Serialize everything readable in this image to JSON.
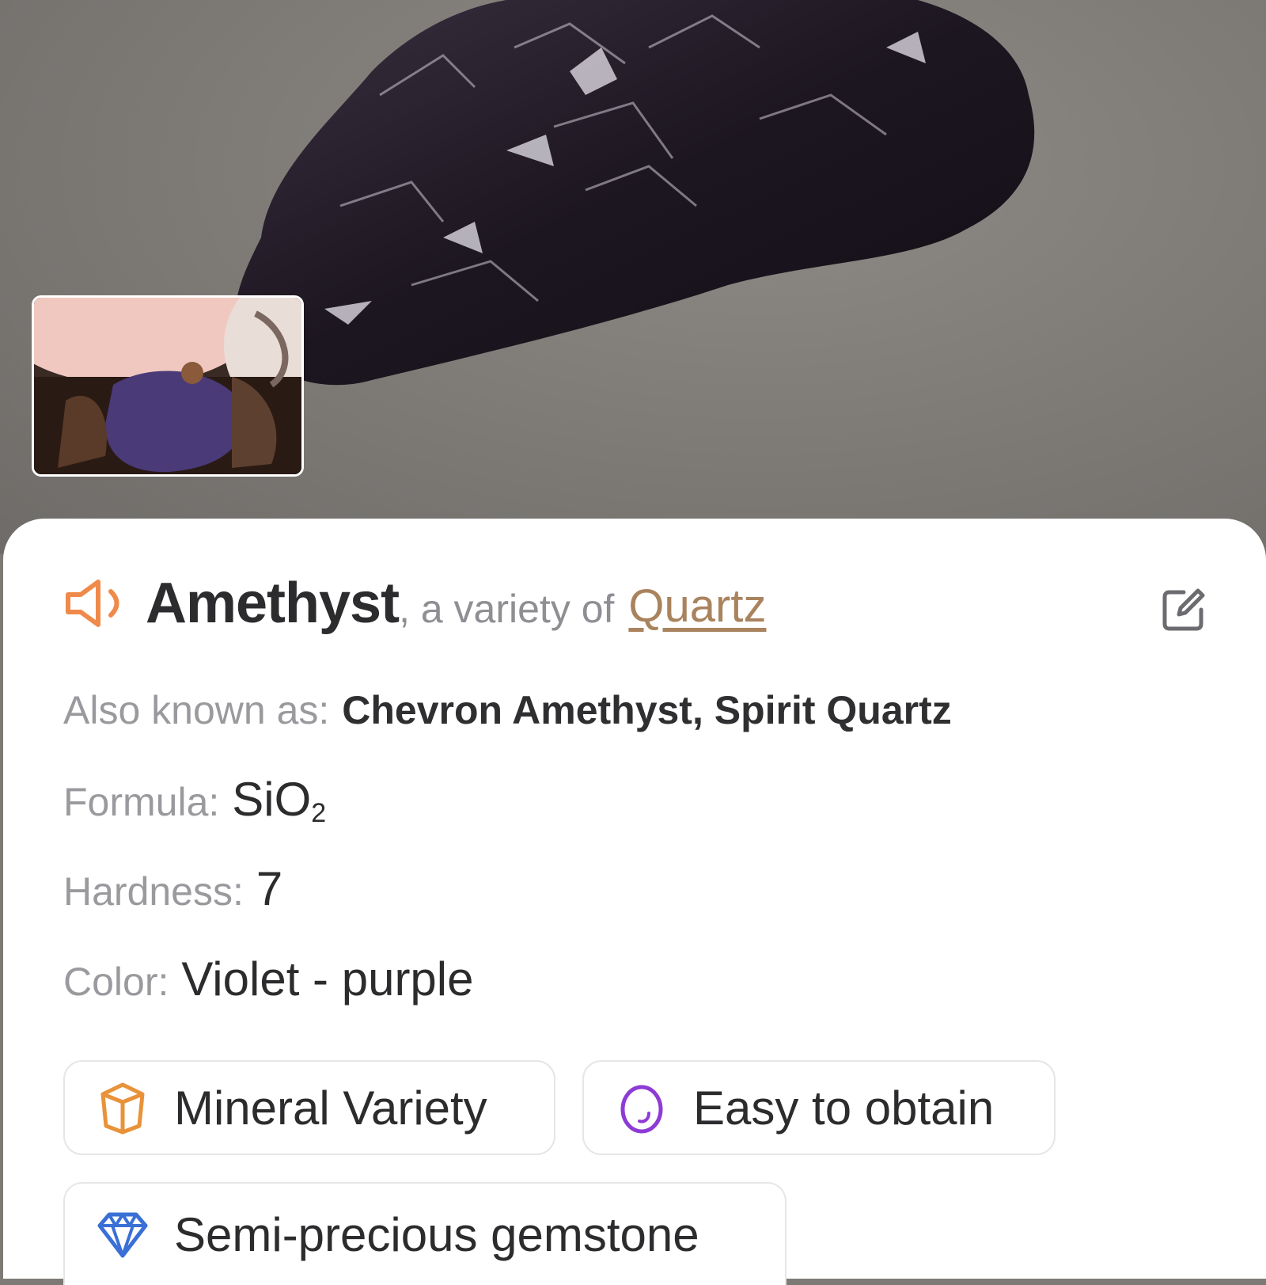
{
  "specimen": {
    "name": "Amethyst",
    "variety_prefix": ", a variety of",
    "variety_link": "Quartz"
  },
  "details": {
    "aka_label": "Also known as:",
    "aka_value": "Chevron Amethyst, Spirit Quartz",
    "formula_label": "Formula:",
    "formula_main": "SiO",
    "formula_sub": "2",
    "hardness_label": "Hardness:",
    "hardness_value": "7",
    "color_label": "Color:",
    "color_value": "Violet - purple"
  },
  "tags": [
    {
      "label": "Mineral Variety",
      "icon": "crystal-icon",
      "color": "#e8923a"
    },
    {
      "label": "Easy to obtain",
      "icon": "ring-icon",
      "color": "#8e3bd6"
    },
    {
      "label": "Semi-precious gemstone",
      "icon": "diamond-icon",
      "color": "#3a6fd6"
    }
  ],
  "colors": {
    "accent": "#f08a4b",
    "link": "#a9835e",
    "label_gray": "#9a9a9e",
    "text_dark": "#2c2c2e"
  }
}
